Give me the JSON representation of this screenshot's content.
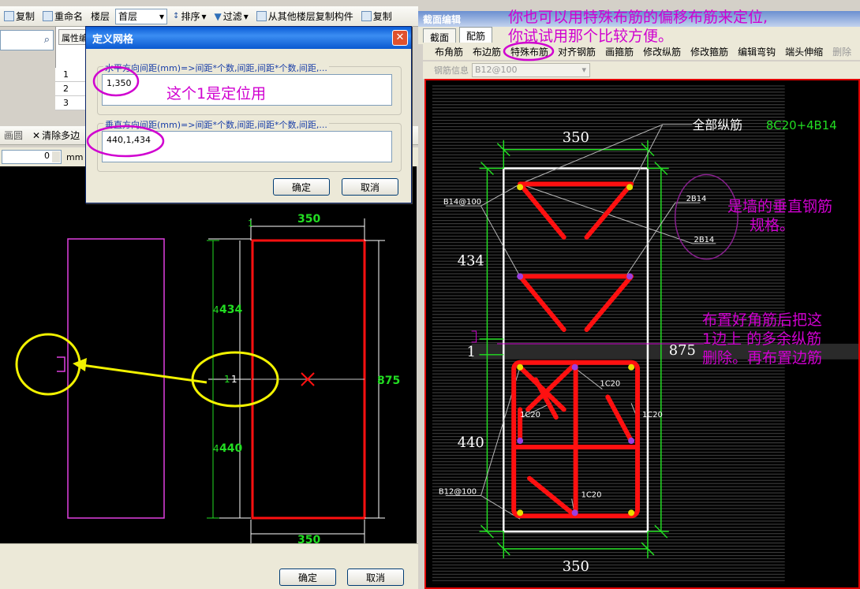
{
  "left_toolbar": {
    "copy_label": "复制",
    "rename_label": "重命名",
    "floor_label": "楼层",
    "floor_value": "首层",
    "sort_label": "排序",
    "filter_label": "过滤",
    "copy_from_floor_label": "从其他楼层复制构件",
    "copy_to_label": "复制"
  },
  "property_panel": {
    "tab_label": "属性编",
    "rows": [
      "1",
      "2",
      "3"
    ]
  },
  "toolbar2": {
    "arc_label": "画圆",
    "clear_label": "清除多边"
  },
  "toolbar3": {
    "spin_value": "0",
    "unit_label": "mm"
  },
  "dialog": {
    "title": "定义网格",
    "horizontal_label": "水平方向间距(mm)=>间距*个数,间距,间距*个数,间距,...",
    "horizontal_value": "1,350",
    "vertical_label": "垂直方向间距(mm)=>间距*个数,间距,间距*个数,间距,...",
    "vertical_value": "440,1,434",
    "ok_label": "确定",
    "cancel_label": "取消"
  },
  "left_drawing": {
    "dim_top": "350",
    "dim_bottom": "350",
    "dim_right": "875",
    "dim_upper": "434",
    "dim_upper_left": "4",
    "dim_lower": "440",
    "dim_lower_left": "4",
    "dim_mid": "1",
    "dim_mid2": "1",
    "dim_top_small": "1",
    "annotation_positioning": "这个1是定位用"
  },
  "left_bottom": {
    "ok_label": "确定",
    "cancel_label": "取消"
  },
  "right_editor": {
    "title": "截面编辑",
    "tab_section": "截面",
    "tab_rebar": "配筋",
    "tools": [
      "布角筋",
      "布边筋",
      "特殊布筋",
      "对齐钢筋",
      "画箍筋",
      "修改纵筋",
      "修改箍筋",
      "编辑弯钩",
      "端头伸缩",
      "删除"
    ],
    "info_label": "钢筋信息",
    "info_value": "B12@100"
  },
  "right_drawing": {
    "dim_top": "350",
    "dim_bottom": "350",
    "dim_right": "875",
    "dim_upper": "434",
    "dim_lower": "440",
    "dim_mid": "1",
    "all_rebar_label": "全部纵筋",
    "all_rebar_value": "8C20+4B14",
    "label_b14_100": "B14@100",
    "label_2b14_a": "2B14",
    "label_2b14_b": "2B14",
    "label_1c20_a": "1C20",
    "label_1c20_b": "1C20",
    "label_1c20_c": "1C20",
    "label_1c20_d": "1C20",
    "label_b12_100": "B12@100"
  },
  "annotations": {
    "top_note_line1": "你也可以用特殊布筋的偏移布筋来定位,",
    "top_note_line2": "你试试用那个比较方便。",
    "wall_note_line1": "是墙的垂直钢筋",
    "wall_note_line2": "规格。",
    "delete_note_line1": "布置好角筋后把这",
    "delete_note_line2": "1边上 的多余纵筋",
    "delete_note_line3": "删除。再布置边筋"
  },
  "colors": {
    "dim_green": "#22dd22",
    "rebar_red": "#ff1010",
    "annotation_magenta": "#d000d0",
    "highlight_yellow": "#f2f200",
    "canvas_black": "#000000"
  }
}
